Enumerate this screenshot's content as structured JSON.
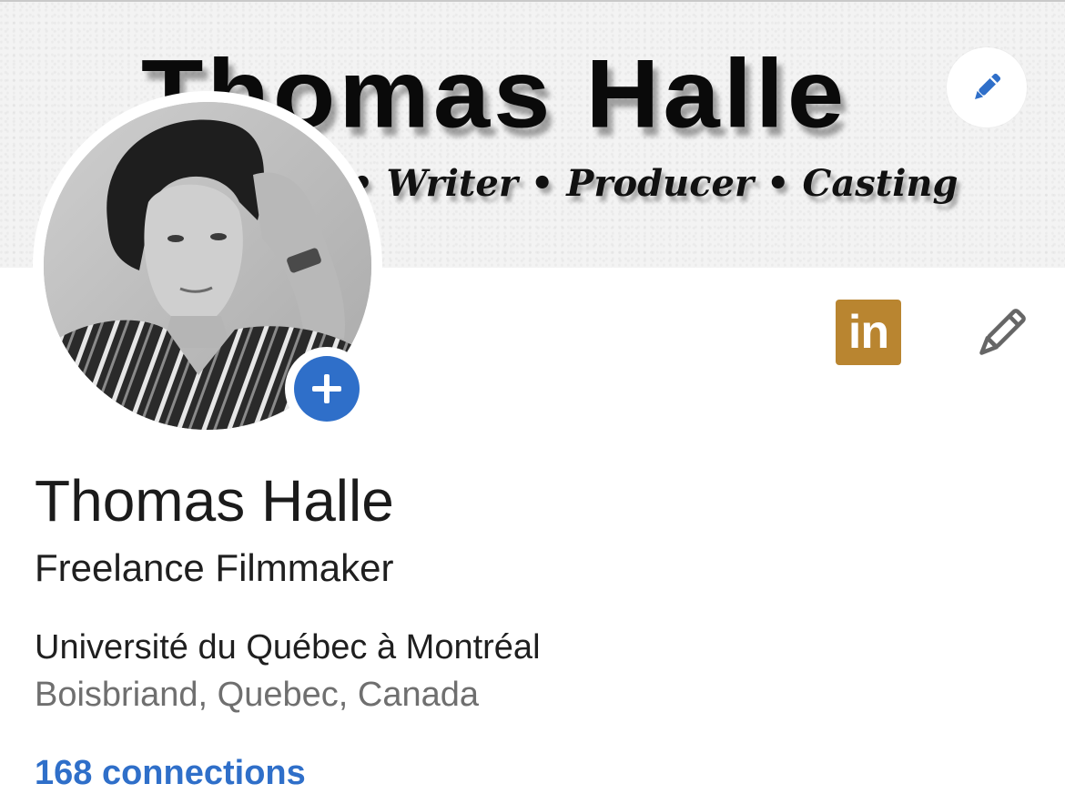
{
  "banner": {
    "title": "Thomas Halle",
    "subtitle": "• Writer • Producer • Casting",
    "edit_icon": "pencil-icon"
  },
  "avatar": {
    "description_icon": "profile-photo",
    "add_icon": "plus-icon"
  },
  "actions": {
    "linkedin_badge_text": "in",
    "edit_icon": "pencil-outline-icon"
  },
  "profile": {
    "name": "Thomas Halle",
    "headline": "Freelance Filmmaker",
    "education": "Université du Québec à Montréal",
    "location": "Boisbriand, Quebec, Canada",
    "connections": "168 connections"
  },
  "colors": {
    "accent_blue": "#2f6fc9",
    "linkedin_badge": "#b98530",
    "text_primary": "#1b1b1b",
    "text_secondary": "#6f6f6f"
  }
}
